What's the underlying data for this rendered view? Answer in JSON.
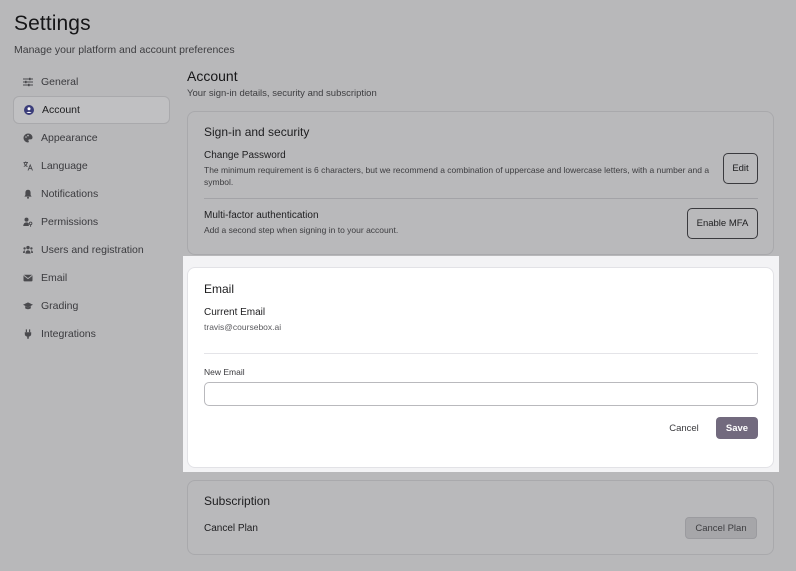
{
  "header": {
    "title": "Settings",
    "subtitle": "Manage your platform and account preferences"
  },
  "sidebar": {
    "items": [
      {
        "label": "General",
        "icon": "sliders-icon",
        "active": false
      },
      {
        "label": "Account",
        "icon": "user-circle-icon",
        "active": true
      },
      {
        "label": "Appearance",
        "icon": "palette-icon",
        "active": false
      },
      {
        "label": "Language",
        "icon": "translate-icon",
        "active": false
      },
      {
        "label": "Notifications",
        "icon": "bell-icon",
        "active": false
      },
      {
        "label": "Permissions",
        "icon": "user-key-icon",
        "active": false
      },
      {
        "label": "Users and registration",
        "icon": "users-icon",
        "active": false
      },
      {
        "label": "Email",
        "icon": "envelope-icon",
        "active": false
      },
      {
        "label": "Grading",
        "icon": "graduation-cap-icon",
        "active": false
      },
      {
        "label": "Integrations",
        "icon": "plug-icon",
        "active": false
      }
    ]
  },
  "account": {
    "title": "Account",
    "subtitle": "Your sign-in details, security and subscription"
  },
  "security": {
    "title": "Sign-in and security",
    "password": {
      "title": "Change Password",
      "description": "The minimum requirement is 6 characters, but we recommend a combination of uppercase and lowercase letters, with a number and a symbol.",
      "button": "Edit"
    },
    "mfa": {
      "title": "Multi-factor authentication",
      "description": "Add a second step when signing in to your account.",
      "button": "Enable MFA"
    }
  },
  "email": {
    "title": "Email",
    "current_label": "Current Email",
    "current_value": "travis@coursebox.ai",
    "new_label": "New Email",
    "new_value": "",
    "new_placeholder": "",
    "cancel": "Cancel",
    "save": "Save"
  },
  "subscription": {
    "title": "Subscription",
    "row_label": "Cancel Plan",
    "button": "Cancel Plan"
  },
  "colors": {
    "accent": "#726a7e",
    "overlay": "#b8b8ba"
  }
}
